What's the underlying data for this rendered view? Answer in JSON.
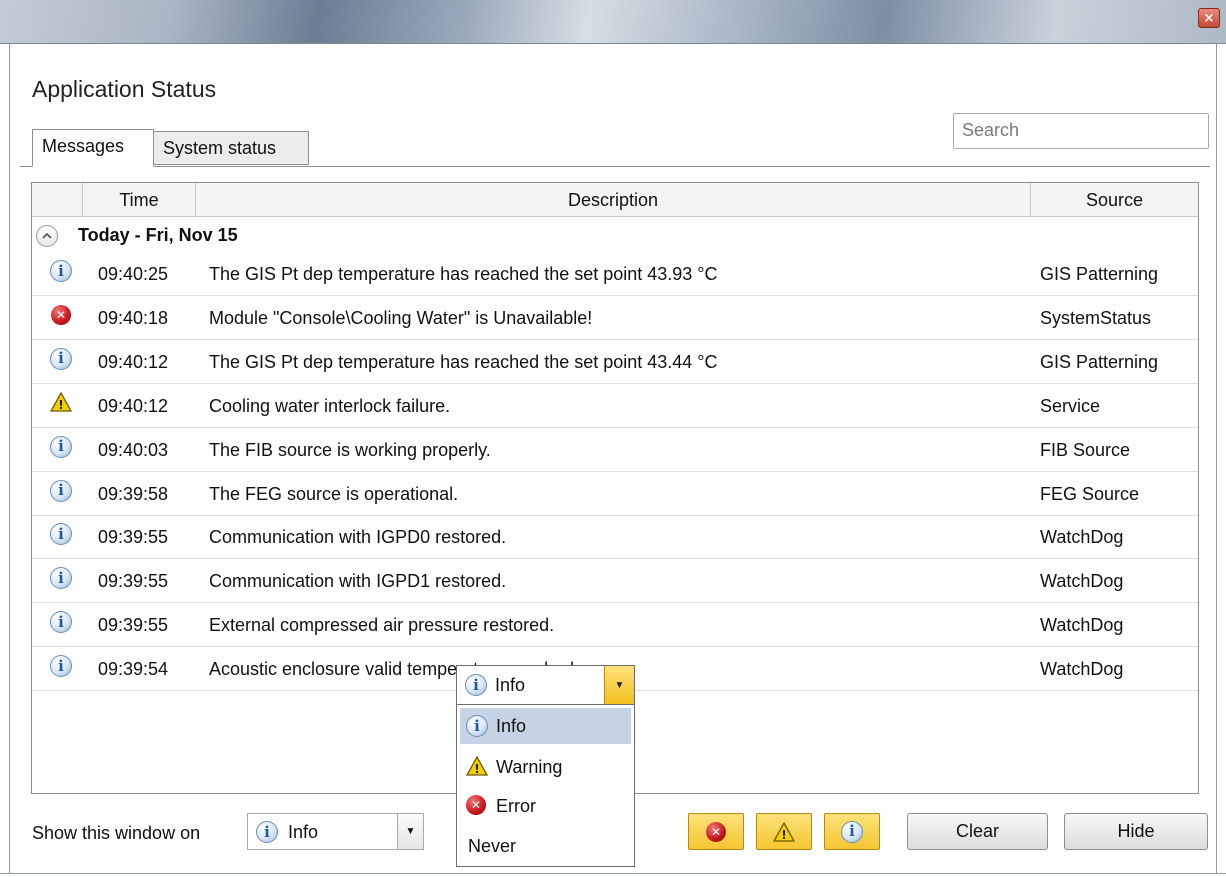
{
  "window": {
    "close_symbol": "×"
  },
  "app": {
    "title": "Application Status"
  },
  "tabs": [
    {
      "label": "Messages",
      "active": true
    },
    {
      "label": "System status",
      "active": false
    }
  ],
  "search": {
    "placeholder": "Search",
    "value": ""
  },
  "table": {
    "columns": [
      "",
      "Time",
      "Description",
      "Source"
    ],
    "group": {
      "label": "Today - Fri, Nov 15",
      "collapse_symbol": "^"
    },
    "rows": [
      {
        "level": "info",
        "time": "09:40:25",
        "description": "The GIS Pt dep temperature has reached the set point 43.93 °C",
        "source": "GIS Patterning"
      },
      {
        "level": "error",
        "time": "09:40:18",
        "description": "Module \"Console\\Cooling Water\" is Unavailable!",
        "source": "SystemStatus"
      },
      {
        "level": "info",
        "time": "09:40:12",
        "description": "The GIS Pt dep temperature has reached the set point 43.44 °C",
        "source": "GIS Patterning"
      },
      {
        "level": "warning",
        "time": "09:40:12",
        "description": "Cooling water interlock failure.",
        "source": "Service"
      },
      {
        "level": "info",
        "time": "09:40:03",
        "description": "The FIB source is working properly.",
        "source": "FIB Source"
      },
      {
        "level": "info",
        "time": "09:39:58",
        "description": "The FEG source is operational.",
        "source": "FEG Source"
      },
      {
        "level": "info",
        "time": "09:39:55",
        "description": "Communication with IGPD0 restored.",
        "source": "WatchDog"
      },
      {
        "level": "info",
        "time": "09:39:55",
        "description": "Communication with IGPD1 restored.",
        "source": "WatchDog"
      },
      {
        "level": "info",
        "time": "09:39:55",
        "description": "External compressed air pressure restored.",
        "source": "WatchDog"
      },
      {
        "level": "info",
        "time": "09:39:54",
        "description": "Acoustic enclosure valid temperature reached.",
        "source": "WatchDog"
      }
    ]
  },
  "footer": {
    "show_label": "Show this window on",
    "show_value": "Info",
    "clear_label": "Clear",
    "hide_label": "Hide"
  },
  "dropdown": {
    "current": "Info",
    "options": [
      {
        "label": "Info",
        "icon": "info-icon",
        "selected": true
      },
      {
        "label": "Warning",
        "icon": "warning-icon",
        "selected": false
      },
      {
        "label": "Error",
        "icon": "error-icon",
        "selected": false
      },
      {
        "label": "Never",
        "icon": "",
        "selected": false
      }
    ]
  },
  "colors": {
    "filter_button": "#f4c631",
    "selected_option": "#c5d3e4",
    "info": "#1a5aa8",
    "error": "#c4161c",
    "warning": "#f5d000"
  },
  "icons": {
    "info_glyph": "i",
    "error_glyph": "✕",
    "warning_glyph": "!",
    "arrow_glyph": "▼"
  }
}
